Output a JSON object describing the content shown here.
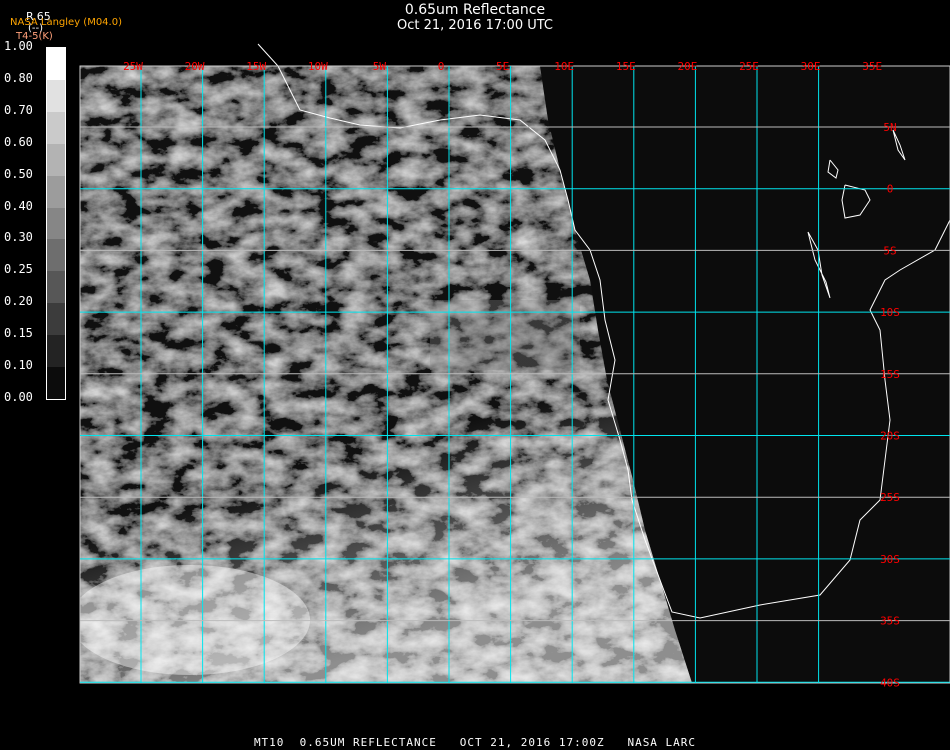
{
  "header": {
    "title": "0.65um Reflectance",
    "datetime": "Oct 21, 2016 17:00 UTC",
    "source": "NASA Langley (M04.0)",
    "channel_label": "R.65",
    "channel_units": "(--)",
    "secondary_label": "T4-5(K)"
  },
  "legend": {
    "ticks": [
      "0.00",
      "0.10",
      "0.15",
      "0.20",
      "0.25",
      "0.30",
      "0.40",
      "0.50",
      "0.60",
      "0.70",
      "0.80",
      "1.00"
    ],
    "colors": [
      "#0c0c0c",
      "#232323",
      "#3c3c3c",
      "#575757",
      "#6e6e6e",
      "#868686",
      "#9c9c9c",
      "#b3b3b3",
      "#cacaca",
      "#e1e1e1",
      "#ffffff"
    ]
  },
  "map": {
    "lon_labels": [
      "25W",
      "20W",
      "15W",
      "10W",
      "5W",
      "0",
      "5E",
      "10E",
      "15E",
      "20E",
      "25E",
      "30E",
      "35E"
    ],
    "lat_labels": [
      "5N",
      "0",
      "5S",
      "10S",
      "15S",
      "20S",
      "25S",
      "30S",
      "35S",
      "40S"
    ],
    "grid_color": "#00e5ee",
    "label_color": "#ff0000",
    "coast_color": "#ffffff"
  },
  "footer": {
    "text": "MT10  0.65UM REFLECTANCE   OCT 21, 2016 17:00Z   NASA LARC"
  }
}
